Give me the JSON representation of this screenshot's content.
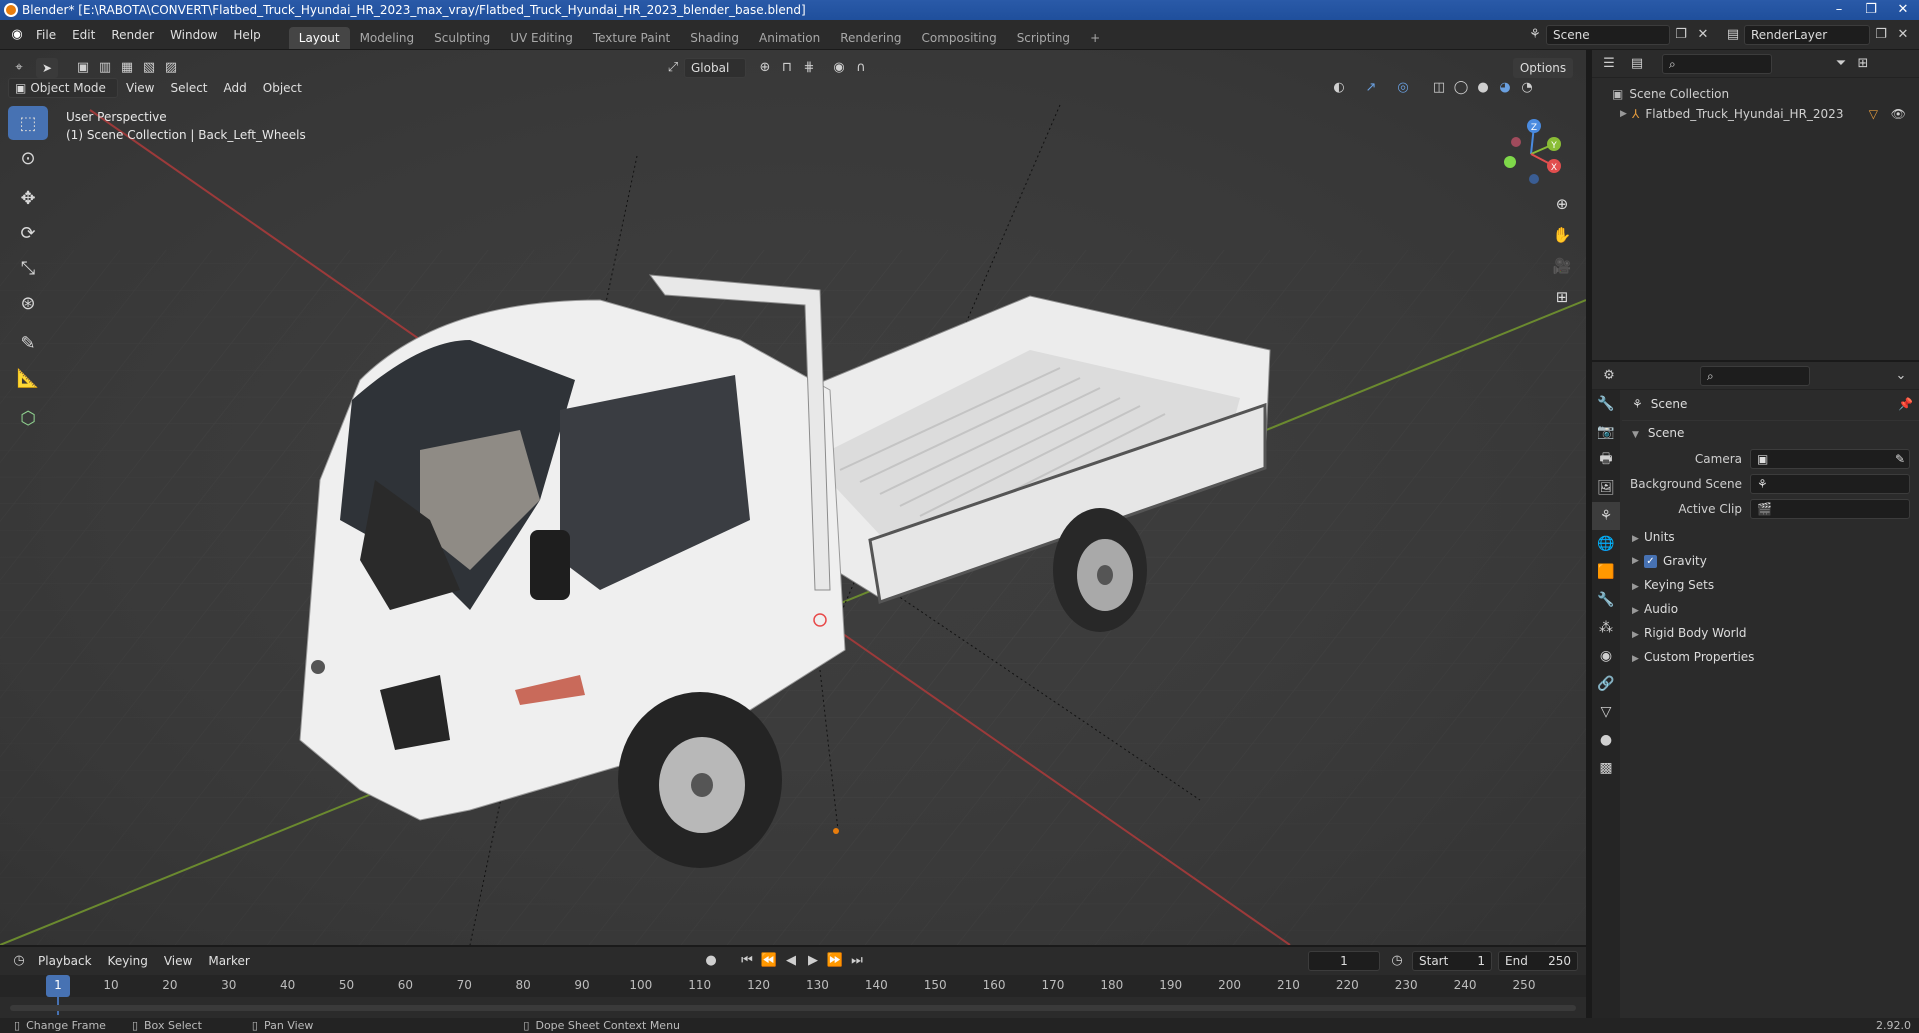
{
  "titlebar": {
    "title": "Blender* [E:\\RABOTA\\CONVERT\\Flatbed_Truck_Hyundai_HR_2023_max_vray/Flatbed_Truck_Hyundai_HR_2023_blender_base.blend]",
    "minimize": "–",
    "restore": "❐",
    "close": "✕"
  },
  "menu": [
    "File",
    "Edit",
    "Render",
    "Window",
    "Help"
  ],
  "workspaces": [
    "Layout",
    "Modeling",
    "Sculpting",
    "UV Editing",
    "Texture Paint",
    "Shading",
    "Animation",
    "Rendering",
    "Compositing",
    "Scripting"
  ],
  "active_workspace": "Layout",
  "add_workspace": "+",
  "scene_selector": {
    "value": "Scene"
  },
  "renderlayer_selector": {
    "value": "RenderLayer"
  },
  "viewport": {
    "mode": "Object Mode",
    "menus": [
      "View",
      "Select",
      "Add",
      "Object"
    ],
    "transform_orientation": "Global",
    "options_label": "Options",
    "info_line1": "User Perspective",
    "info_line2": "(1) Scene Collection | Back_Left_Wheels",
    "gizmo": {
      "x": "X",
      "y": "Y",
      "z": "Z"
    }
  },
  "outliner": {
    "root": "Scene Collection",
    "items": [
      {
        "label": "Flatbed_Truck_Hyundai_HR_2023"
      }
    ]
  },
  "properties": {
    "header": "Scene",
    "section": "Scene",
    "fields": [
      {
        "label": "Camera",
        "value": ""
      },
      {
        "label": "Background Scene",
        "value": ""
      },
      {
        "label": "Active Clip",
        "value": ""
      }
    ],
    "subpanels": [
      "Units",
      "Gravity",
      "Keying Sets",
      "Audio",
      "Rigid Body World",
      "Custom Properties"
    ],
    "gravity_checked": true
  },
  "timeline": {
    "menus": [
      "Playback",
      "Keying",
      "View",
      "Marker"
    ],
    "current_frame": "1",
    "start_label": "Start",
    "start": "1",
    "end_label": "End",
    "end": "250",
    "ticks": [
      "1",
      "10",
      "20",
      "30",
      "40",
      "50",
      "60",
      "70",
      "80",
      "90",
      "100",
      "110",
      "120",
      "130",
      "140",
      "150",
      "160",
      "170",
      "180",
      "190",
      "200",
      "210",
      "220",
      "230",
      "240",
      "250"
    ]
  },
  "statusbar": {
    "items": [
      "Change Frame",
      "Box Select",
      "Pan View",
      "Dope Sheet Context Menu"
    ],
    "version": "2.92.0"
  }
}
